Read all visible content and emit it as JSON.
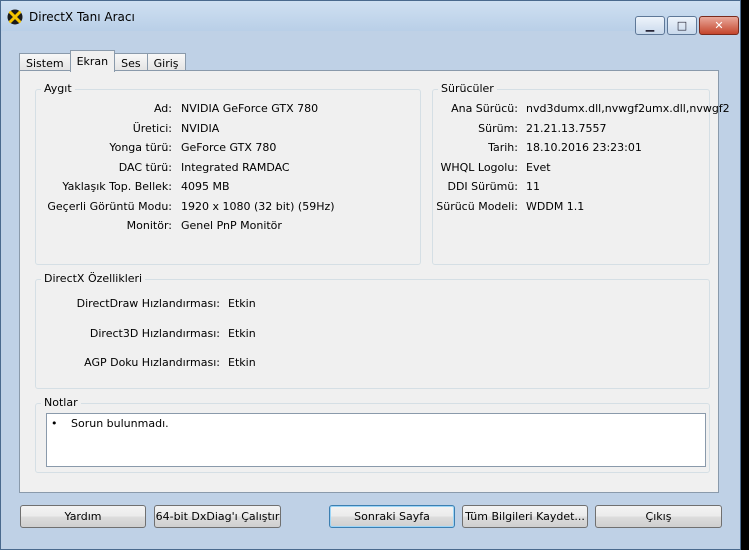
{
  "window": {
    "title": "DirectX Tanı Aracı"
  },
  "tabs": [
    {
      "label": "Sistem"
    },
    {
      "label": "Ekran"
    },
    {
      "label": "Ses"
    },
    {
      "label": "Giriş"
    }
  ],
  "device": {
    "title": "Aygıt",
    "rows": [
      {
        "label": "Ad:",
        "value": "NVIDIA GeForce GTX 780"
      },
      {
        "label": "Üretici:",
        "value": "NVIDIA"
      },
      {
        "label": "Yonga türü:",
        "value": "GeForce GTX 780"
      },
      {
        "label": "DAC türü:",
        "value": "Integrated RAMDAC"
      },
      {
        "label": "Yaklaşık Top. Bellek:",
        "value": "4095 MB"
      },
      {
        "label": "Geçerli Görüntü Modu:",
        "value": "1920 x 1080 (32 bit) (59Hz)"
      },
      {
        "label": "Monitör:",
        "value": "Genel PnP Monitör"
      }
    ]
  },
  "drivers": {
    "title": "Sürücüler",
    "rows": [
      {
        "label": "Ana Sürücü:",
        "value": "nvd3dumx.dll,nvwgf2umx.dll,nvwgf2"
      },
      {
        "label": "Sürüm:",
        "value": "21.21.13.7557"
      },
      {
        "label": "Tarih:",
        "value": "18.10.2016 23:23:01"
      },
      {
        "label": "WHQL Logolu:",
        "value": "Evet"
      },
      {
        "label": "DDI Sürümü:",
        "value": "11"
      },
      {
        "label": "Sürücü Modeli:",
        "value": "WDDM 1.1"
      }
    ]
  },
  "features": {
    "title": "DirectX Özellikleri",
    "rows": [
      {
        "label": "DirectDraw Hızlandırması:",
        "value": "Etkin"
      },
      {
        "label": "Direct3D Hızlandırması:",
        "value": "Etkin"
      },
      {
        "label": "AGP Doku Hızlandırması:",
        "value": "Etkin"
      }
    ]
  },
  "notes": {
    "title": "Notlar",
    "bullet": "•",
    "text": "Sorun bulunmadı."
  },
  "buttons": {
    "help": "Yardım",
    "run64": "64-bit DxDiag'ı Çalıştır",
    "next": "Sonraki Sayfa",
    "save": "Tüm Bilgileri Kaydet...",
    "exit": "Çıkış"
  }
}
